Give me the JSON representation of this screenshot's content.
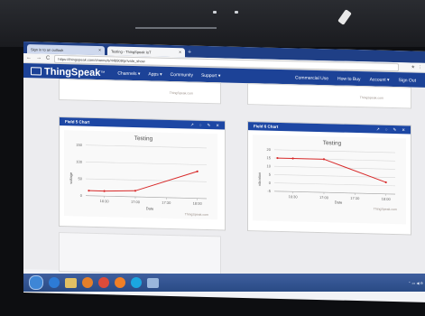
{
  "browser": {
    "tabs": [
      {
        "label": "Sign in to an outlook",
        "close": "×"
      },
      {
        "label": "Testing - ThingSpeak IoT",
        "close": "×"
      }
    ],
    "new_tab": "+",
    "url": "https://thingspeak.com/channels/448909/private_show",
    "nav_back": "←",
    "nav_forward": "→",
    "nav_reload": "C"
  },
  "thingspeak_nav": {
    "logo": "ThingSpeak",
    "logo_tm": "™",
    "left": [
      "Channels ▾",
      "Apps ▾",
      "Community",
      "Support ▾"
    ],
    "right": [
      "Commercial Use",
      "How to Buy",
      "Account ▾",
      "Sign Out"
    ]
  },
  "credit": "ThingSpeak.com",
  "panels": [
    {
      "title": "Field 5 Chart",
      "tools": [
        "↗",
        "◌",
        "✎",
        "✕"
      ]
    },
    {
      "title": "Field 6 Chart",
      "tools": [
        "↗",
        "◌",
        "✎",
        "✕"
      ]
    }
  ],
  "chart_data": [
    {
      "type": "line",
      "title": "Testing",
      "xlabel": "Date",
      "ylabel": "voltage",
      "x": [
        "16:30",
        "17:00",
        "17:30",
        "18:00"
      ],
      "yticks": [
        0,
        50,
        100,
        150
      ],
      "ylim": [
        0,
        150
      ],
      "series": [
        {
          "values": [
            [
              16.25,
              15
            ],
            [
              16.5,
              15
            ],
            [
              17.0,
              18
            ],
            [
              18.0,
              80
            ]
          ],
          "color": "#d82a2a"
        }
      ],
      "grid": true
    },
    {
      "type": "line",
      "title": "Testing",
      "xlabel": "Date",
      "ylabel": "vibration",
      "x": [
        "16:30",
        "17:00",
        "17:30",
        "18:00"
      ],
      "yticks": [
        -5,
        0,
        5,
        10,
        15,
        20
      ],
      "ylim": [
        -5,
        20
      ],
      "series": [
        {
          "values": [
            [
              16.25,
              15
            ],
            [
              16.5,
              15
            ],
            [
              17.0,
              15
            ],
            [
              18.0,
              2
            ]
          ],
          "color": "#d82a2a"
        }
      ],
      "grid": true
    }
  ],
  "taskbar": {
    "icons": [
      "start-orb",
      "ie",
      "folder",
      "media",
      "chrome",
      "firefox",
      "skype",
      "paint"
    ],
    "colors": {
      "start-orb": "#3e86d6",
      "ie": "#2d7bd6",
      "folder": "#e2c064",
      "media": "#e47f2a",
      "chrome": "#dc4b3a",
      "firefox": "#f07f26",
      "skype": "#1ba6e0",
      "paint": "#9ab6dc"
    },
    "tray": "⌃ ▭ ◀ ⟰"
  }
}
